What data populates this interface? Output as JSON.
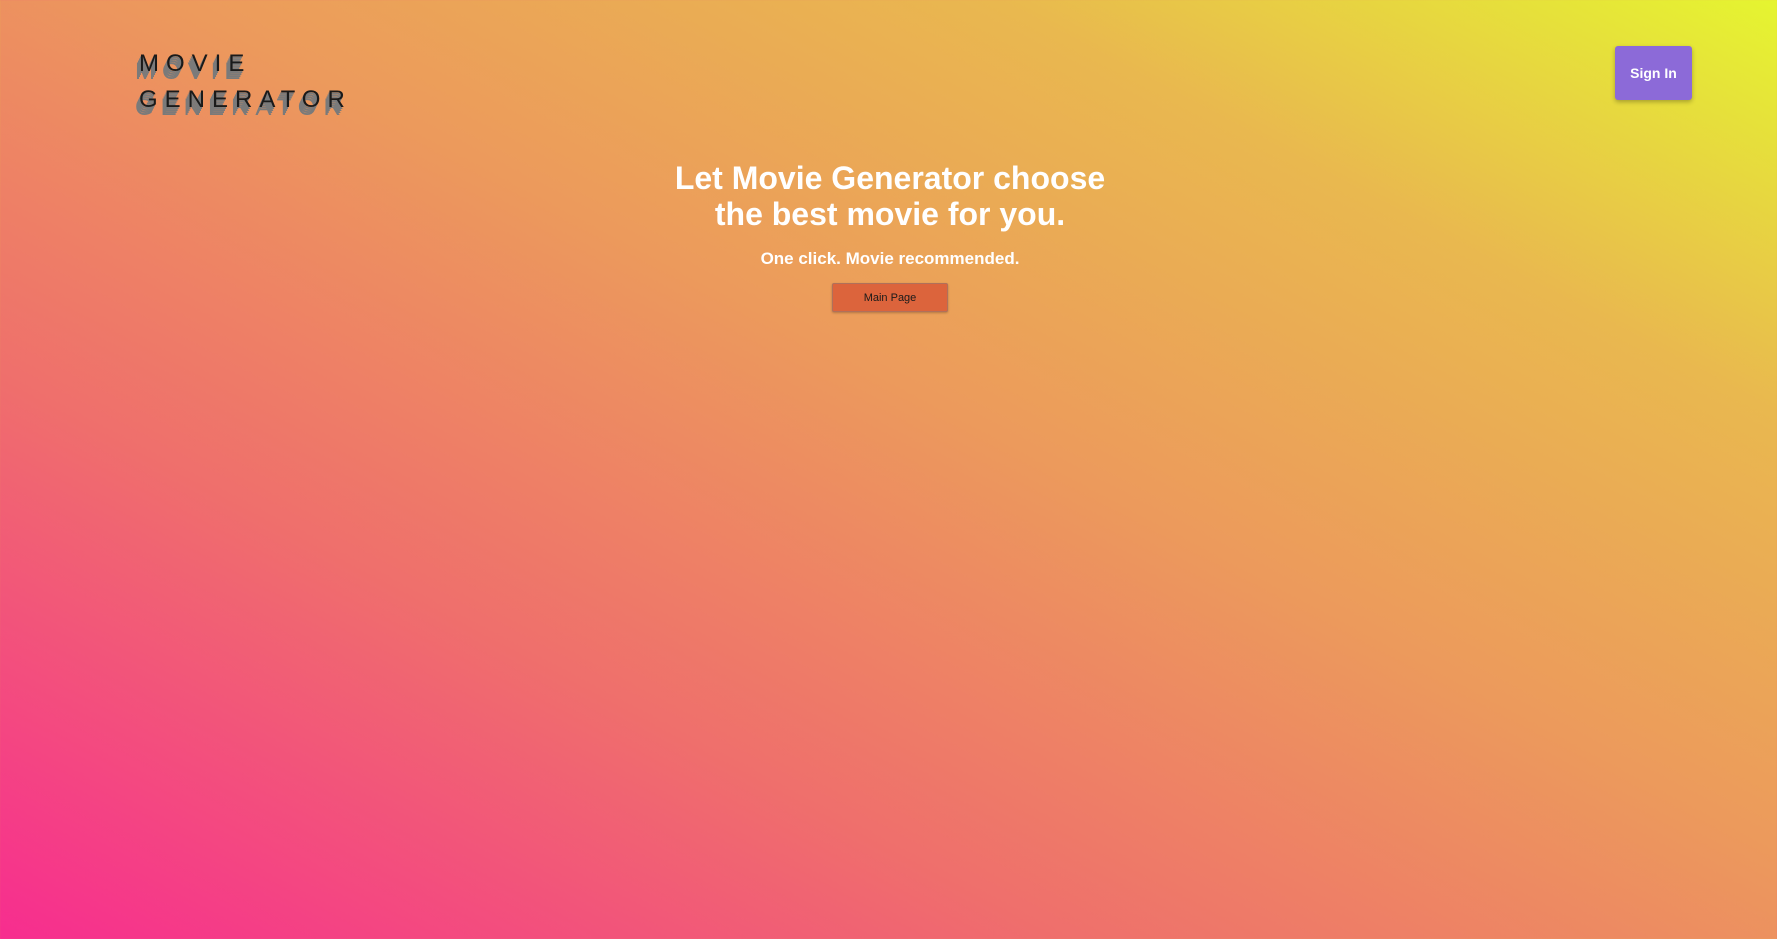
{
  "header": {
    "logo_line1": "MOVIE",
    "logo_line2": "GENERATOR",
    "signin_label": "Sign In"
  },
  "hero": {
    "title_line1": "Let Movie Generator choose",
    "title_line2": "the best movie for you.",
    "subtitle": "One click. Movie recommended.",
    "main_page_label": "Main Page"
  },
  "colors": {
    "gradient_bottom_left": "#f72d8f",
    "gradient_top_right": "#e5f530",
    "signin_button": "#8c6ad8",
    "main_page_button": "#dc643c"
  }
}
